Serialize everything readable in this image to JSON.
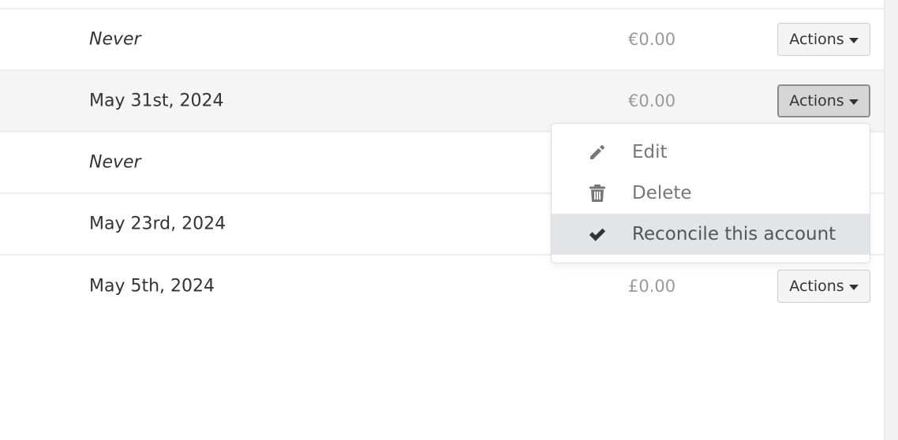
{
  "rows": [
    {
      "date": "Never",
      "amount": "€0.00",
      "action": "Actions"
    },
    {
      "date": "May 31st, 2024",
      "amount": "€0.00",
      "action": "Actions"
    },
    {
      "date": "Never",
      "amount": "",
      "action": ""
    },
    {
      "date": "May 23rd, 2024",
      "amount": "",
      "action": ""
    },
    {
      "date": "May 5th, 2024",
      "amount": "£0.00",
      "action": "Actions"
    }
  ],
  "menu": {
    "items": [
      {
        "label": "Edit",
        "icon": "pencil-icon"
      },
      {
        "label": "Delete",
        "icon": "trash-icon"
      },
      {
        "label": "Reconcile this account",
        "icon": "check-icon",
        "highlighted": true
      }
    ]
  },
  "colors": {
    "amount": "#999999",
    "active_row": "#f5f5f5",
    "menu_highlight": "#e3e4e6"
  }
}
